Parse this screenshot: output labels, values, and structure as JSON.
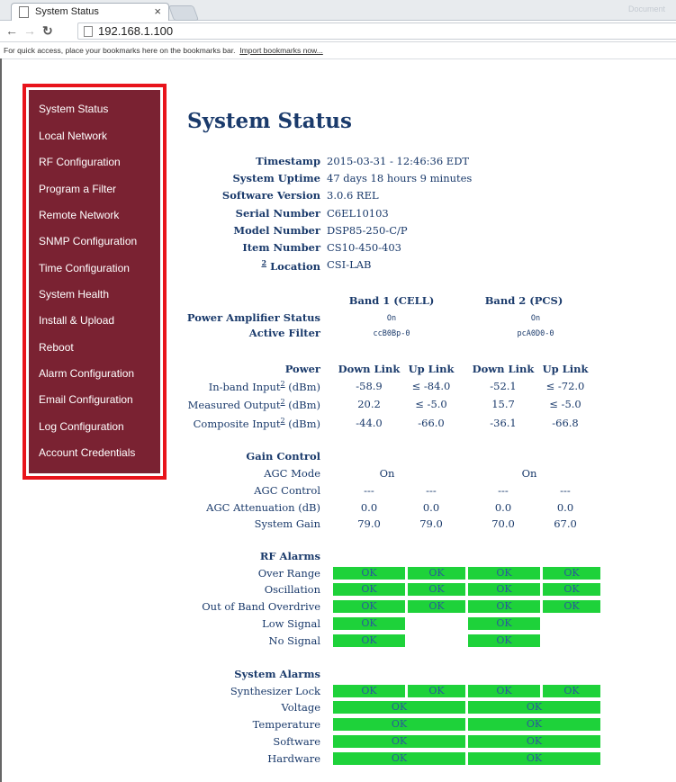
{
  "browser": {
    "tab_title": "System Status",
    "tab_close": "×",
    "url": "192.168.1.100",
    "bookmark_hint": "For quick access, place your bookmarks here on the bookmarks bar.",
    "bookmark_link": "Import bookmarks now...",
    "user_label": "Document"
  },
  "sidebar": {
    "items": [
      "System Status",
      "Local Network",
      "RF Configuration",
      "Program a Filter",
      "Remote Network",
      "SNMP Configuration",
      "Time Configuration",
      "System Health",
      "Install & Upload",
      "Reboot",
      "Alarm Configuration",
      "Email Configuration",
      "Log Configuration",
      "Account Credentials"
    ]
  },
  "main": {
    "title": "System Status",
    "info": [
      {
        "label": "Timestamp",
        "value": "2015-03-31 - 12:46:36 EDT"
      },
      {
        "label": "System Uptime",
        "value": "47 days 18 hours 9 minutes"
      },
      {
        "label": "Software Version",
        "value": "3.0.6 REL"
      },
      {
        "label": "Serial Number",
        "value": "C6EL10103"
      },
      {
        "label": "Model Number",
        "value": "DSP85-250-C/P"
      },
      {
        "label": "Item Number",
        "value": "CS10-450-403"
      },
      {
        "label": "Location",
        "sup": "2",
        "value": "CSI-LAB"
      }
    ],
    "bands": [
      "Band 1 (CELL)",
      "Band 2 (PCS)"
    ],
    "pa_status": {
      "label": "Power Amplifier Status",
      "values": [
        "On",
        "On"
      ]
    },
    "active_filter": {
      "label": "Active Filter",
      "values": [
        "ccB0Bp-0",
        "pcA0D0-0"
      ]
    },
    "power": {
      "header": "Power",
      "columns": [
        "Down Link",
        "Up Link",
        "Down Link",
        "Up Link"
      ],
      "rows": [
        {
          "label": "In-band Input",
          "unit": " (dBm)",
          "sup": "2",
          "values": [
            "-58.9",
            "≤ -84.0",
            "-52.1",
            "≤ -72.0"
          ]
        },
        {
          "label": "Measured Output",
          "unit": " (dBm)",
          "sup": "2",
          "values": [
            "20.2",
            "≤ -5.0",
            "15.7",
            "≤ -5.0"
          ]
        },
        {
          "label": "Composite Input",
          "unit": " (dBm)",
          "sup": "2",
          "values": [
            "-44.0",
            "-66.0",
            "-36.1",
            "-66.8"
          ]
        }
      ]
    },
    "gain": {
      "header": "Gain Control",
      "agc_mode": {
        "label": "AGC Mode",
        "values": [
          "On",
          "On"
        ]
      },
      "rows": [
        {
          "label": "AGC Control",
          "values": [
            "---",
            "---",
            "---",
            "---"
          ]
        },
        {
          "label": "AGC Attenuation (dB)",
          "values": [
            "0.0",
            "0.0",
            "0.0",
            "0.0"
          ]
        },
        {
          "label": "System Gain",
          "values": [
            "79.0",
            "79.0",
            "70.0",
            "67.0"
          ]
        }
      ]
    },
    "rf_alarms": {
      "header": "RF Alarms",
      "rows": [
        {
          "label": "Over Range",
          "values": [
            "OK",
            "OK",
            "OK",
            "OK"
          ]
        },
        {
          "label": "Oscillation",
          "values": [
            "OK",
            "OK",
            "OK",
            "OK"
          ]
        },
        {
          "label": "Out of Band Overdrive",
          "values": [
            "OK",
            "OK",
            "OK",
            "OK"
          ]
        },
        {
          "label": "Low Signal",
          "values": [
            "OK",
            "OK"
          ]
        },
        {
          "label": "No Signal",
          "values": [
            "OK",
            "OK"
          ]
        }
      ]
    },
    "system_alarms": {
      "header": "System Alarms",
      "synth": {
        "label": "Synthesizer Lock",
        "values": [
          "OK",
          "OK",
          "OK",
          "OK"
        ]
      },
      "rows": [
        {
          "label": "Voltage",
          "values": [
            "OK",
            "OK"
          ]
        },
        {
          "label": "Temperature",
          "values": [
            "OK",
            "OK"
          ]
        },
        {
          "label": "Software",
          "values": [
            "OK",
            "OK"
          ]
        },
        {
          "label": "Hardware",
          "values": [
            "OK",
            "OK"
          ]
        }
      ]
    },
    "colors": {
      "ok": "#1ed23a",
      "sidebar": "#7a2232",
      "highlight": "#e8141b",
      "text": "#1a3a6b"
    }
  }
}
